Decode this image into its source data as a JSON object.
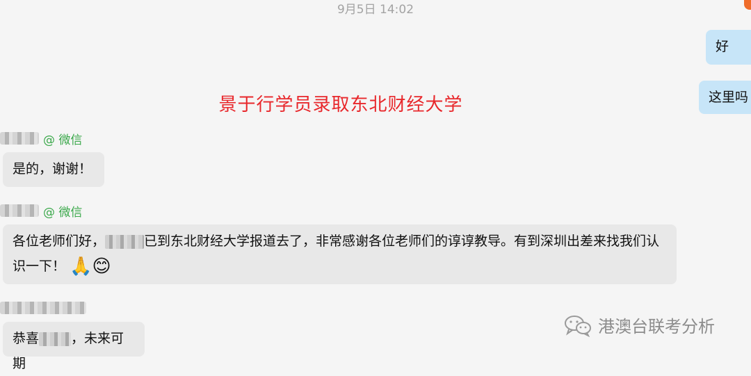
{
  "timestamp": "9月5日 14:02",
  "right_messages": [
    "好",
    "这里吗"
  ],
  "banner": "景于行学员录取东北财经大学",
  "messages": [
    {
      "source": "@ 微信",
      "text": "是的，谢谢！"
    },
    {
      "source": "@ 微信",
      "text_before": "各位老师们好，",
      "text_after": "已到东北财经大学报道去了，非常感谢各位老师们的谆谆教导。有到深圳出差来找我们认识一下！"
    },
    {
      "text_before": "恭喜",
      "text_after": "，未来可期"
    }
  ],
  "icons": [
    "pray-hands-emoji",
    "smiling-face-emoji",
    "wechat-logo-icon"
  ],
  "watermark": "港澳台联考分析",
  "colors": {
    "banner": "#e8272b",
    "source": "#3aa84a",
    "right_bubble": "#c7e5f8",
    "left_bubble": "#e8e8e8"
  }
}
